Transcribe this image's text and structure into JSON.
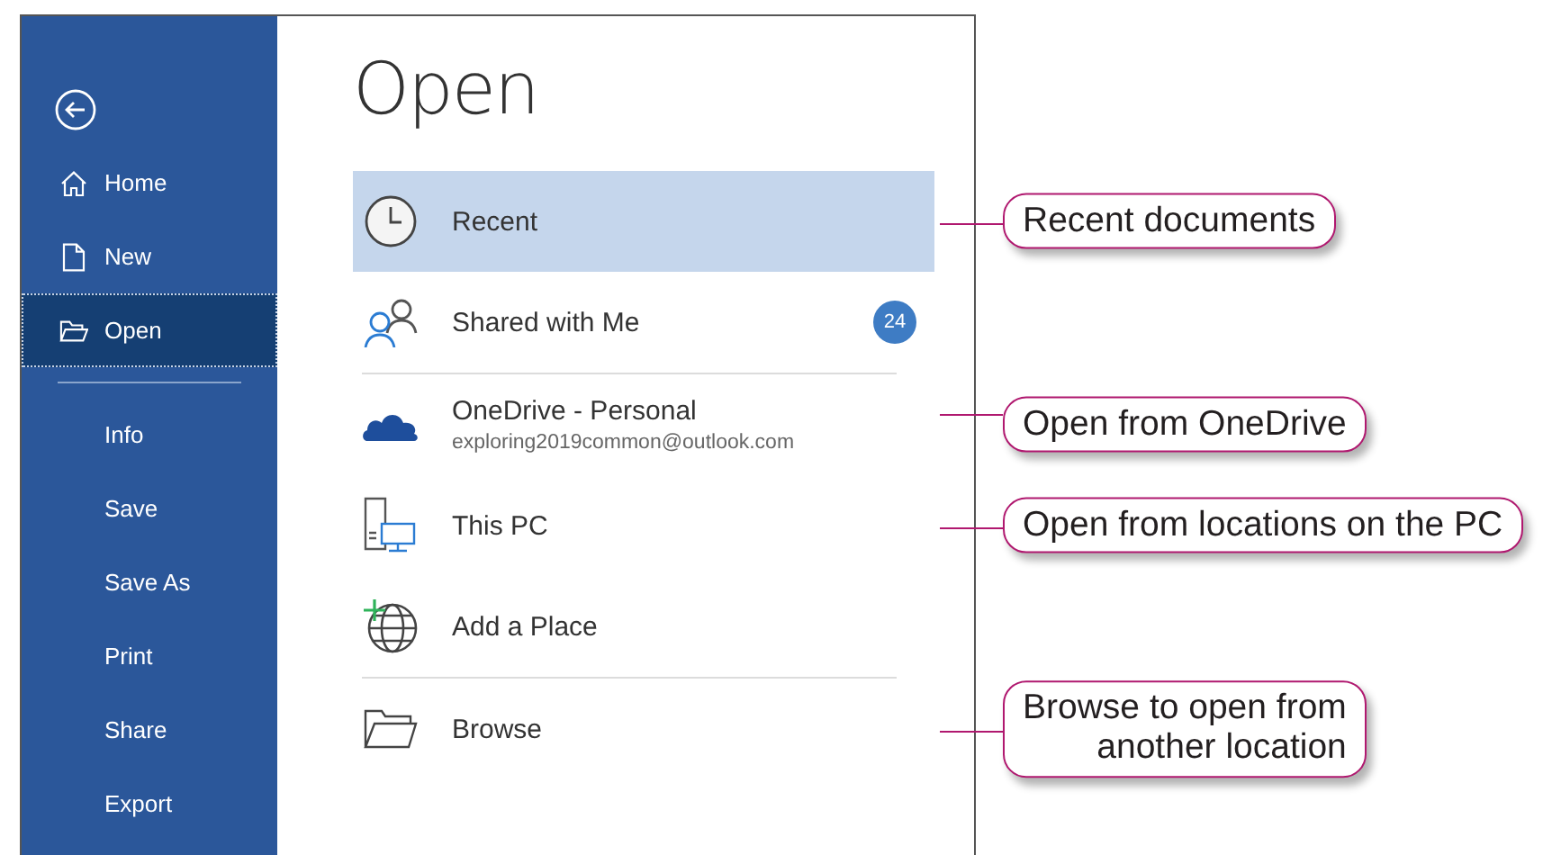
{
  "sidebar": {
    "groups": [
      [
        {
          "label": "Home",
          "selected": false
        },
        {
          "label": "New",
          "selected": false
        },
        {
          "label": "Open",
          "selected": true
        }
      ],
      [
        {
          "label": "Info",
          "selected": false
        },
        {
          "label": "Save",
          "selected": false
        },
        {
          "label": "Save As",
          "selected": false
        },
        {
          "label": "Print",
          "selected": false
        },
        {
          "label": "Share",
          "selected": false
        },
        {
          "label": "Export",
          "selected": false
        }
      ]
    ]
  },
  "title": "Open",
  "place_groups": [
    [
      {
        "label": "Recent",
        "selected": true,
        "callout": [
          "Recent documents"
        ]
      },
      {
        "label": "Shared with Me",
        "selected": false,
        "badge": "24"
      }
    ],
    [
      {
        "label": "OneDrive - Personal",
        "subtitle": "exploring2019common@outlook.com",
        "selected": false,
        "callout": [
          "Open from OneDrive"
        ]
      },
      {
        "label": "This PC",
        "selected": false,
        "callout": [
          "Open from locations on the PC"
        ]
      },
      {
        "label": "Add a Place",
        "selected": false
      }
    ],
    [
      {
        "label": "Browse",
        "selected": false,
        "callout": [
          "Browse to open from",
          "another location"
        ]
      }
    ]
  ]
}
